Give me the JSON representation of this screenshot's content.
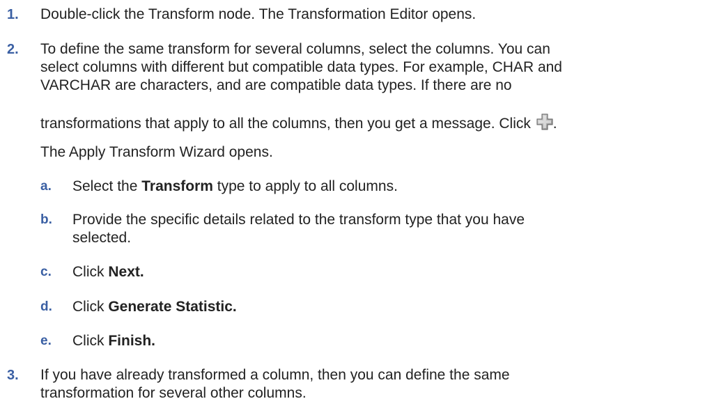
{
  "steps": [
    {
      "number": "1.",
      "lines": [
        "Double-click the Transform node. The Transformation Editor opens."
      ]
    },
    {
      "number": "2.",
      "lines": [
        "To define the same transform for several columns, select the columns. You can",
        "select columns with different but compatible data types. For example, CHAR and",
        "VARCHAR are characters, and are compatible data types. If there are no",
        "transformations that apply to all the columns, then you get a message. Click",
        "The Apply Transform Wizard opens."
      ],
      "click_suffix": ".",
      "substeps": [
        {
          "letter": "a.",
          "pre": "Select the ",
          "bold": "Transform",
          "post": " type to apply to all columns."
        },
        {
          "letter": "b.",
          "line1": "Provide the specific details related to the transform type that you have",
          "line2": "selected."
        },
        {
          "letter": "c.",
          "pre": "Click ",
          "bold": "Next.",
          "post": ""
        },
        {
          "letter": "d.",
          "pre": "Click ",
          "bold": "Generate Statistic.",
          "post": ""
        },
        {
          "letter": "e.",
          "pre": "Click ",
          "bold": "Finish.",
          "post": ""
        }
      ]
    },
    {
      "number": "3.",
      "lines": [
        "If you have already transformed a column, then you can define the same",
        "transformation for several other columns."
      ]
    }
  ],
  "icons": {
    "apply_transform": "add-transform-icon"
  },
  "colors": {
    "step_number": "#3a5fa3",
    "text": "#222222"
  }
}
